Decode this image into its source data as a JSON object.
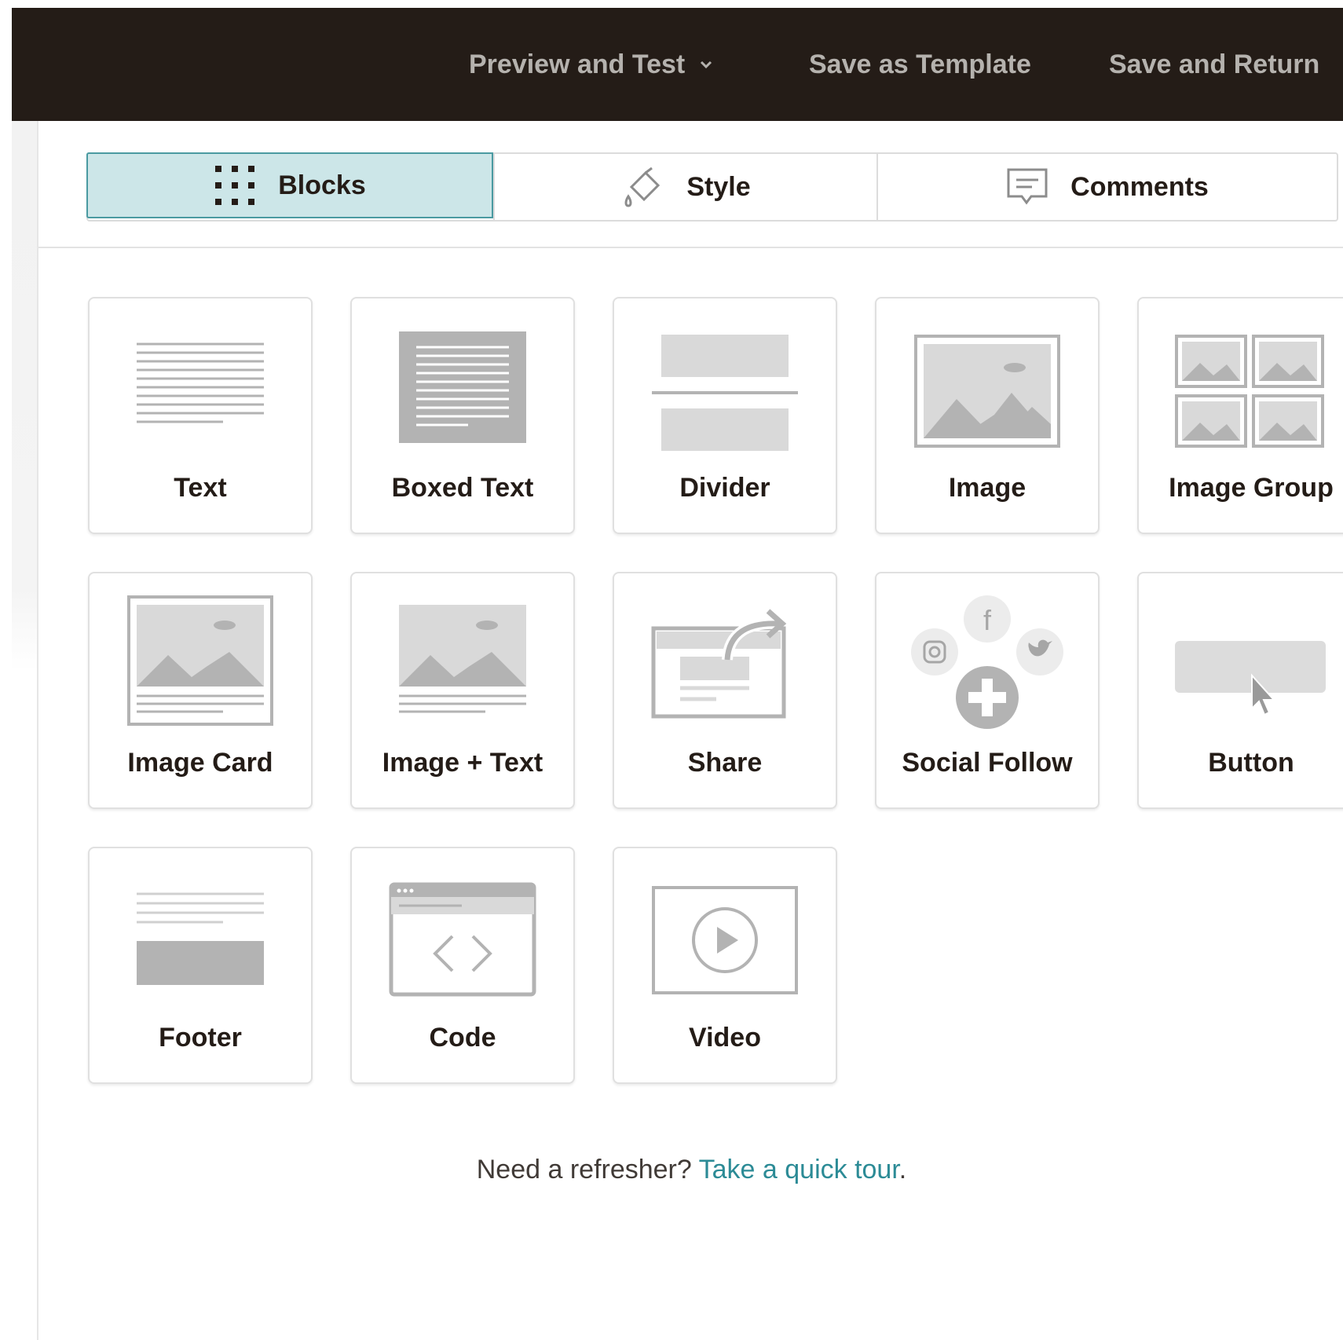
{
  "topbar": {
    "preview_label": "Preview and Test",
    "save_template_label": "Save as Template",
    "save_return_label": "Save and Return"
  },
  "tabs": [
    {
      "label": "Blocks",
      "icon": "grid-dots-icon",
      "active": true
    },
    {
      "label": "Style",
      "icon": "paint-bucket-icon",
      "active": false
    },
    {
      "label": "Comments",
      "icon": "comment-icon",
      "active": false
    }
  ],
  "blocks": [
    {
      "label": "Text",
      "icon": "text-block-icon"
    },
    {
      "label": "Boxed Text",
      "icon": "boxed-text-icon"
    },
    {
      "label": "Divider",
      "icon": "divider-icon"
    },
    {
      "label": "Image",
      "icon": "image-icon"
    },
    {
      "label": "Image Group",
      "icon": "image-group-icon"
    },
    {
      "label": "Image Card",
      "icon": "image-card-icon"
    },
    {
      "label": "Image + Text",
      "icon": "image-text-icon"
    },
    {
      "label": "Share",
      "icon": "share-icon"
    },
    {
      "label": "Social Follow",
      "icon": "social-follow-icon"
    },
    {
      "label": "Button",
      "icon": "button-block-icon"
    },
    {
      "label": "Footer",
      "icon": "footer-icon"
    },
    {
      "label": "Code",
      "icon": "code-icon"
    },
    {
      "label": "Video",
      "icon": "video-icon"
    }
  ],
  "refresher": {
    "text": "Need a refresher? ",
    "link": "Take a quick tour",
    "end": "."
  },
  "colors": {
    "topbar": "#241c17",
    "active_tab": "#cce6e8",
    "link": "#2c8b96",
    "icon_gray": "#b3b3b3"
  }
}
